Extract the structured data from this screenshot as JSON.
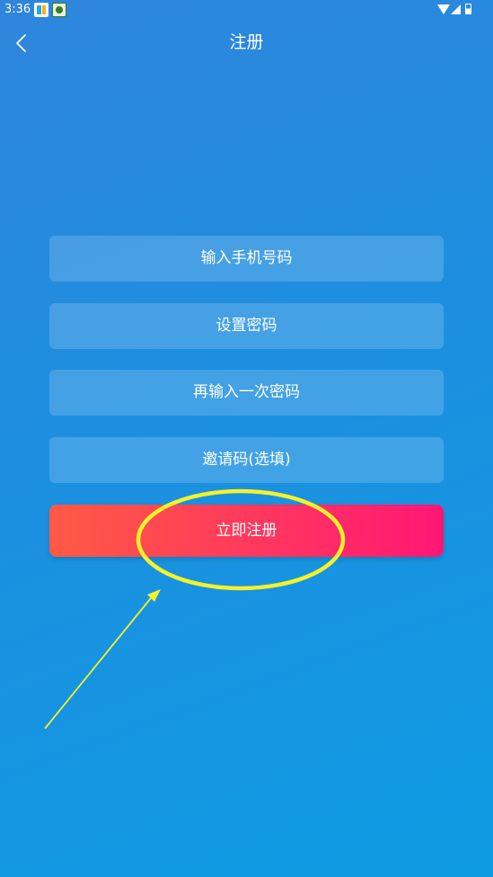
{
  "status_bar": {
    "time": "3:36"
  },
  "header": {
    "title": "注册",
    "back_icon": "chevron-left-icon"
  },
  "form": {
    "phone_placeholder": "输入手机号码",
    "password_placeholder": "设置密码",
    "password_confirm_placeholder": "再输入一次密码",
    "invite_placeholder": "邀请码(选填)",
    "submit_label": "立即注册"
  },
  "colors": {
    "background_start": "#2f86dc",
    "background_end": "#0e9be2",
    "button_start": "#ff5a45",
    "button_end": "#ff1675",
    "annotation": "#f4f22a"
  }
}
